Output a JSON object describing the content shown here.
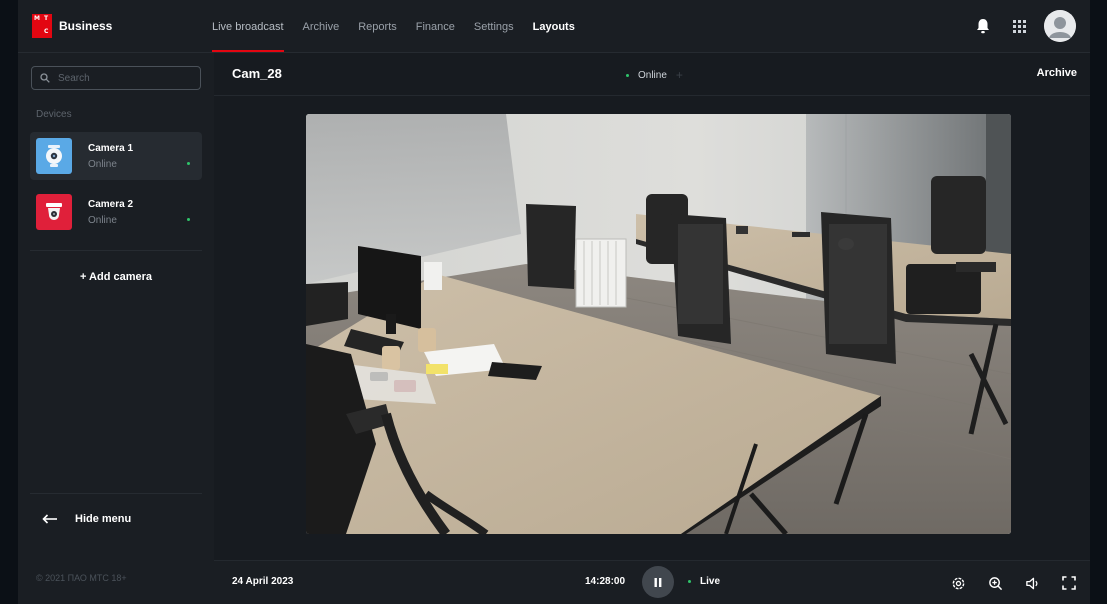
{
  "brand": {
    "logo_letters": [
      "М",
      "Т",
      "С"
    ],
    "name": "Business",
    "accent_color": "#e30611"
  },
  "nav": {
    "items": [
      {
        "label": "Live broadcast",
        "state": "active"
      },
      {
        "label": "Archive",
        "state": "normal"
      },
      {
        "label": "Reports",
        "state": "normal"
      },
      {
        "label": "Finance",
        "state": "normal"
      },
      {
        "label": "Settings",
        "state": "normal"
      },
      {
        "label": "Layouts",
        "state": "bright"
      }
    ]
  },
  "top_icons": [
    "bell-icon",
    "apps-grid-icon",
    "user-avatar"
  ],
  "sidebar": {
    "search_placeholder": "Search",
    "section_label": "Devices",
    "devices": [
      {
        "name": "Camera 1",
        "status": "Online",
        "thumb_color": "#5aa9e6",
        "selected": true,
        "icon": "dome-camera-icon"
      },
      {
        "name": "Camera 2",
        "status": "Online",
        "thumb_color": "#e0203a",
        "selected": false,
        "icon": "ceiling-camera-icon"
      }
    ],
    "add_camera": "+ Add camera",
    "hide_menu": "Hide menu",
    "copyright": "© 2021 ПАО МТС 18+"
  },
  "camera_view": {
    "title": "Cam_28",
    "status": "Online",
    "archive_link": "Archive",
    "status_color": "#2fc46a"
  },
  "player": {
    "date": "24 April 2023",
    "time": "14:28:00",
    "live_label": "Live",
    "tools": [
      "settings-icon",
      "zoom-in-icon",
      "volume-icon",
      "fullscreen-icon"
    ]
  }
}
